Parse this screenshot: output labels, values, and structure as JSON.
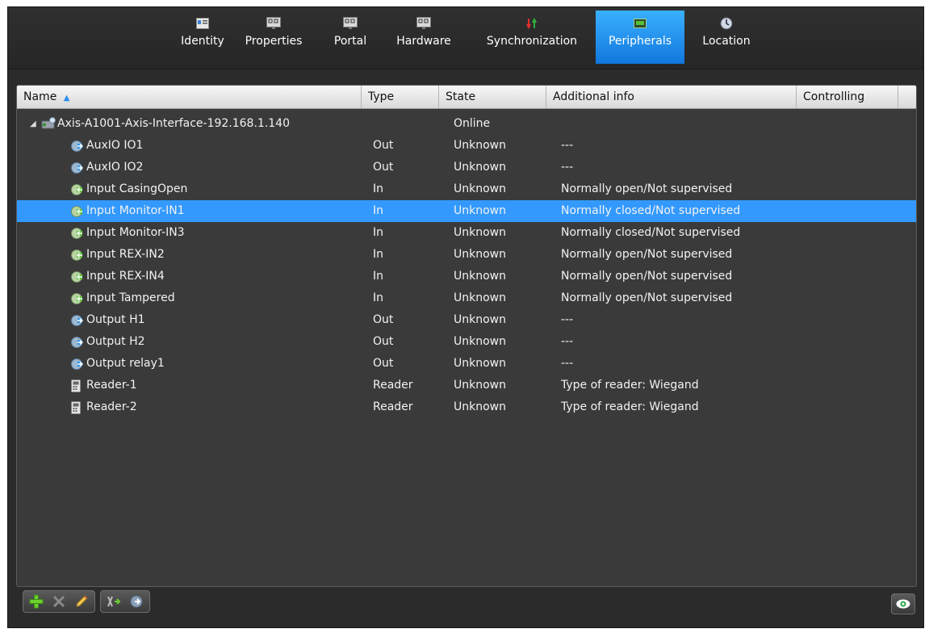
{
  "tabs": [
    {
      "label": "Identity",
      "icon": "identity-icon",
      "active": false
    },
    {
      "label": "Properties",
      "icon": "properties-icon",
      "active": false
    },
    {
      "label": "Portal",
      "icon": "portal-icon",
      "active": false
    },
    {
      "label": "Hardware",
      "icon": "hardware-icon",
      "active": false
    },
    {
      "label": "Synchronization",
      "icon": "sync-icon",
      "active": false
    },
    {
      "label": "Peripherals",
      "icon": "peripherals-icon",
      "active": true
    },
    {
      "label": "Location",
      "icon": "location-icon",
      "active": false
    }
  ],
  "table": {
    "columns": [
      "Name",
      "Type",
      "State",
      "Additional info",
      "Controlling"
    ],
    "sort_column": "Name",
    "sort_direction": "ascending",
    "device": {
      "name": "Axis-A1001-Axis-Interface-192.168.1.140",
      "type": "",
      "state": "Online",
      "info": ""
    },
    "rows": [
      {
        "name": "AuxIO IO1",
        "type": "Out",
        "state": "Unknown",
        "info": "---",
        "icon": "output-icon",
        "selected": false
      },
      {
        "name": "AuxIO IO2",
        "type": "Out",
        "state": "Unknown",
        "info": "---",
        "icon": "output-icon",
        "selected": false
      },
      {
        "name": "Input CasingOpen",
        "type": "In",
        "state": "Unknown",
        "info": "Normally open/Not supervised",
        "icon": "input-icon",
        "selected": false
      },
      {
        "name": "Input Monitor-IN1",
        "type": "In",
        "state": "Unknown",
        "info": "Normally closed/Not supervised",
        "icon": "input-icon",
        "selected": true
      },
      {
        "name": "Input Monitor-IN3",
        "type": "In",
        "state": "Unknown",
        "info": "Normally closed/Not supervised",
        "icon": "input-icon",
        "selected": false
      },
      {
        "name": "Input REX-IN2",
        "type": "In",
        "state": "Unknown",
        "info": "Normally open/Not supervised",
        "icon": "input-icon",
        "selected": false
      },
      {
        "name": "Input REX-IN4",
        "type": "In",
        "state": "Unknown",
        "info": "Normally open/Not supervised",
        "icon": "input-icon",
        "selected": false
      },
      {
        "name": "Input Tampered",
        "type": "In",
        "state": "Unknown",
        "info": "Normally open/Not supervised",
        "icon": "input-icon",
        "selected": false
      },
      {
        "name": "Output H1",
        "type": "Out",
        "state": "Unknown",
        "info": "---",
        "icon": "output-icon",
        "selected": false
      },
      {
        "name": "Output H2",
        "type": "Out",
        "state": "Unknown",
        "info": "---",
        "icon": "output-icon",
        "selected": false
      },
      {
        "name": "Output relay1",
        "type": "Out",
        "state": "Unknown",
        "info": "---",
        "icon": "output-icon",
        "selected": false
      },
      {
        "name": "Reader-1",
        "type": "Reader",
        "state": "Unknown",
        "info": "Type of reader: Wiegand",
        "icon": "reader-icon",
        "selected": false
      },
      {
        "name": "Reader-2",
        "type": "Reader",
        "state": "Unknown",
        "info": "Type of reader: Wiegand",
        "icon": "reader-icon",
        "selected": false
      }
    ]
  },
  "toolbar": {
    "buttons": [
      "add-icon",
      "delete-icon",
      "edit-icon",
      "link-icon",
      "output-action-icon"
    ],
    "view_button": "eye-icon"
  },
  "colors": {
    "selection": "#3399ff",
    "background": "#3a3a3a",
    "active_tab": "#1e8ef0",
    "add": "#6ccf2f"
  }
}
